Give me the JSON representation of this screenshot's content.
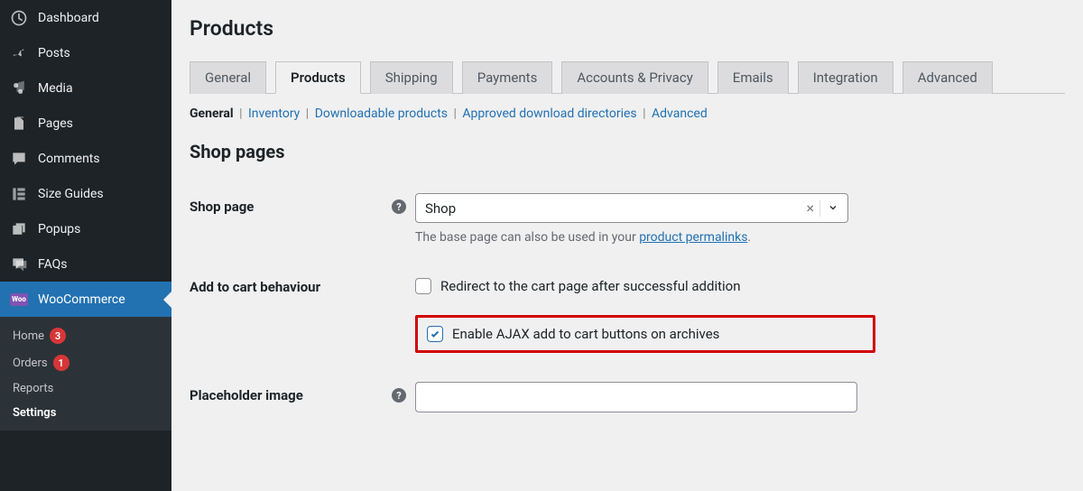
{
  "page_title": "Products",
  "sidebar": {
    "items": [
      {
        "label": "Dashboard",
        "icon": "dashboard"
      },
      {
        "label": "Posts",
        "icon": "pin"
      },
      {
        "label": "Media",
        "icon": "media"
      },
      {
        "label": "Pages",
        "icon": "pages"
      },
      {
        "label": "Comments",
        "icon": "comments"
      },
      {
        "label": "Size Guides",
        "icon": "ruler"
      },
      {
        "label": "Popups",
        "icon": "popup"
      },
      {
        "label": "FAQs",
        "icon": "faq"
      },
      {
        "label": "WooCommerce",
        "icon": "woo"
      }
    ],
    "subitems": [
      {
        "label": "Home",
        "badge": "3"
      },
      {
        "label": "Orders",
        "badge": "1"
      },
      {
        "label": "Reports"
      },
      {
        "label": "Settings"
      }
    ]
  },
  "tabs": [
    {
      "label": "General"
    },
    {
      "label": "Products"
    },
    {
      "label": "Shipping"
    },
    {
      "label": "Payments"
    },
    {
      "label": "Accounts & Privacy"
    },
    {
      "label": "Emails"
    },
    {
      "label": "Integration"
    },
    {
      "label": "Advanced"
    }
  ],
  "subtabs": {
    "current": "General",
    "items": [
      "Inventory",
      "Downloadable products",
      "Approved download directories",
      "Advanced"
    ]
  },
  "section_title": "Shop pages",
  "shop_page": {
    "label": "Shop page",
    "value": "Shop",
    "help": "The base page can also be used in your ",
    "help_link": "product permalinks"
  },
  "add_to_cart": {
    "label": "Add to cart behaviour",
    "opt_redirect": "Redirect to the cart page after successful addition",
    "opt_ajax": "Enable AJAX add to cart buttons on archives"
  },
  "placeholder": {
    "label": "Placeholder image",
    "value": ""
  }
}
